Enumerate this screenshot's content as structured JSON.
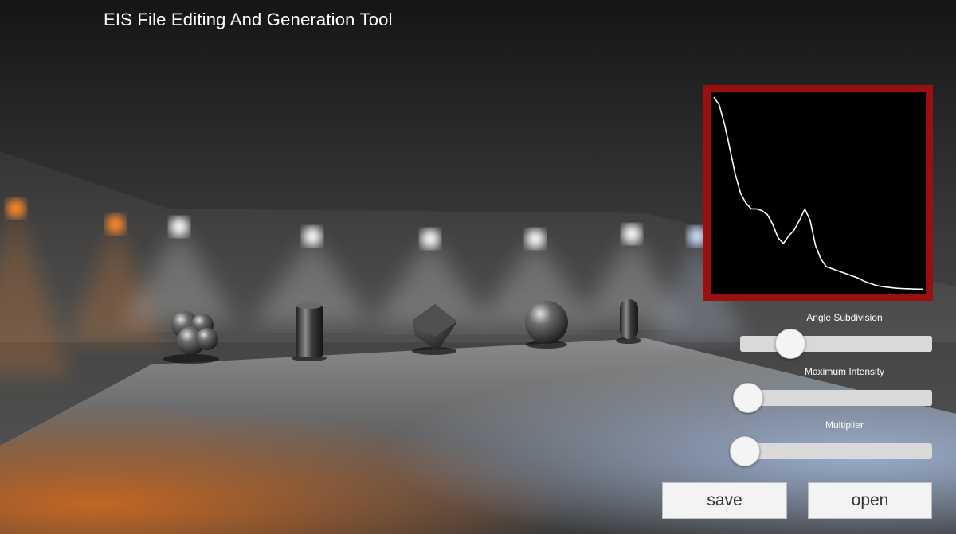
{
  "app": {
    "title": "EIS File Editing And Generation Tool"
  },
  "graph": {
    "frame_color": "#9a1010",
    "line_color": "#ffffff",
    "profile": [
      1.0,
      0.96,
      0.86,
      0.73,
      0.6,
      0.5,
      0.45,
      0.42,
      0.42,
      0.41,
      0.39,
      0.34,
      0.27,
      0.24,
      0.28,
      0.31,
      0.36,
      0.42,
      0.36,
      0.23,
      0.16,
      0.12,
      0.11,
      0.1,
      0.09,
      0.08,
      0.07,
      0.06,
      0.045,
      0.035,
      0.025,
      0.018,
      0.014,
      0.011,
      0.008,
      0.006,
      0.005,
      0.004,
      0.003,
      0.003
    ]
  },
  "controls": {
    "sliders": [
      {
        "label": "Angle Subdivision",
        "value": 0.26
      },
      {
        "label": "Maximum Intensity",
        "value": 0.0
      },
      {
        "label": "Multiplier",
        "value": 0.0
      }
    ],
    "save_label": "save",
    "open_label": "open"
  },
  "scene": {
    "warm_light_color": "#ff8a2a",
    "cold_light_color": "#cfe0ff",
    "white_light_color": "#ffffff"
  }
}
